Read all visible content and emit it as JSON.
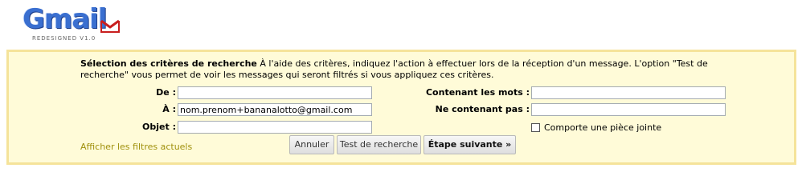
{
  "app": {
    "logo_text": "Gmail",
    "logo_subtitle": "REDESIGNED V1.0"
  },
  "filter": {
    "heading": "Sélection des critères de recherche",
    "description": "À l'aide des critères, indiquez l'action à effectuer lors de la réception d'un message. L'option \"Test de recherche\" vous permet de voir les messages qui seront filtrés si vous appliquez ces critères.",
    "fields": {
      "from": {
        "label": "De :",
        "value": ""
      },
      "to": {
        "label": "À :",
        "value": "nom.prenom+bananalotto@gmail.com"
      },
      "subject": {
        "label": "Objet :",
        "value": ""
      },
      "has_words": {
        "label": "Contenant les mots :",
        "value": ""
      },
      "doesnt_have": {
        "label": "Ne contenant pas :",
        "value": ""
      }
    },
    "has_attachment": {
      "label": "Comporte une pièce jointe",
      "checked": false
    },
    "show_filters_link": "Afficher les filtres actuels",
    "buttons": {
      "cancel": "Annuler",
      "test": "Test de recherche",
      "next": "Étape suivante »"
    }
  }
}
